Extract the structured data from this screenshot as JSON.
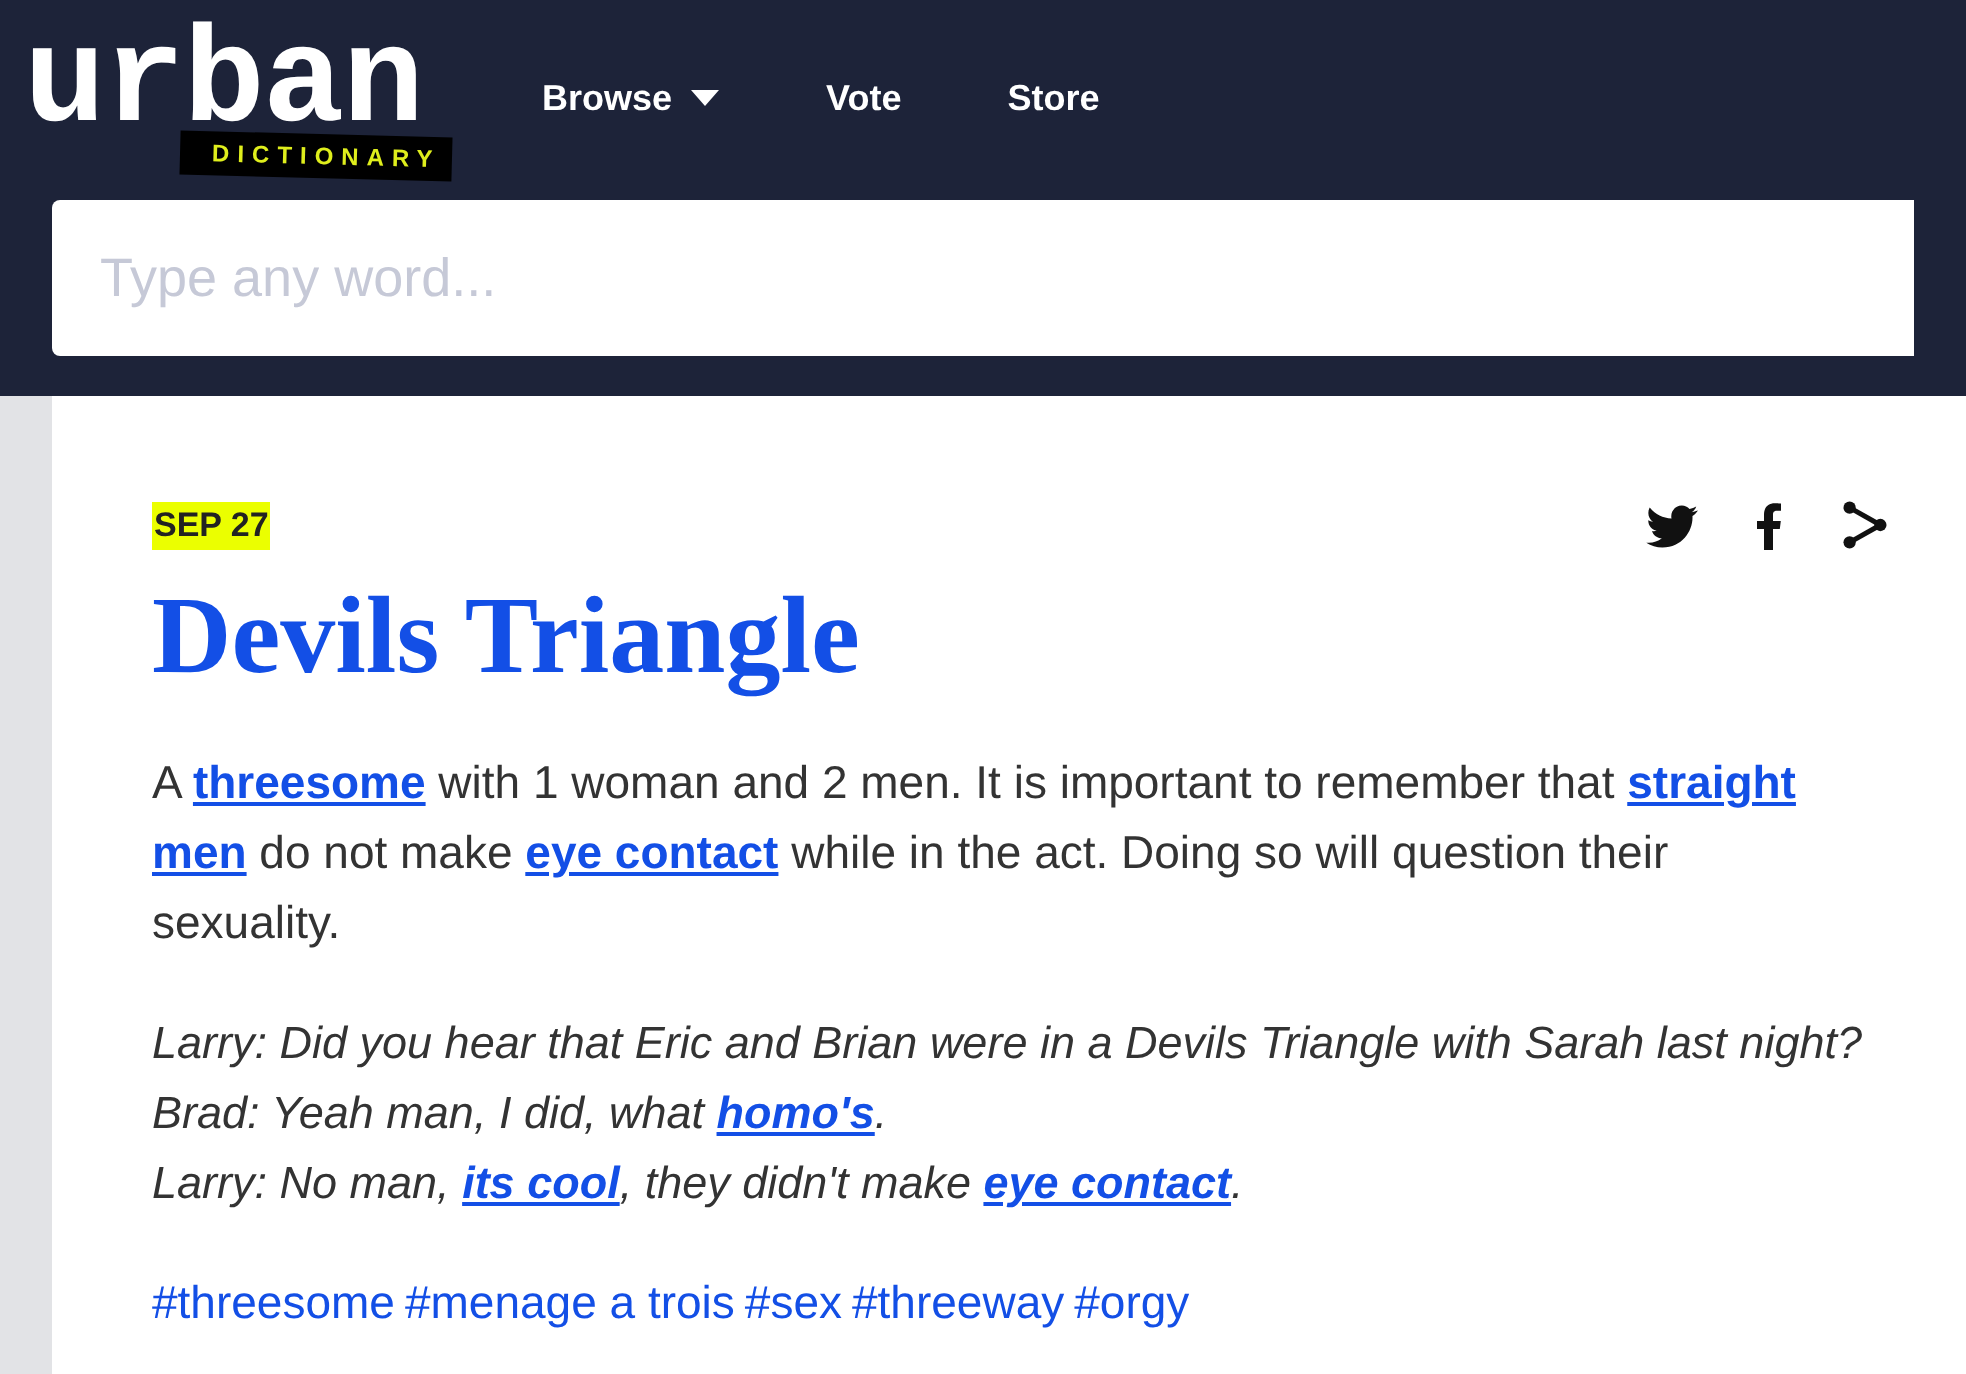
{
  "header": {
    "logo": {
      "wordmark": "urban",
      "tagline": "DICTIONARY"
    },
    "nav": [
      {
        "label": "Browse",
        "kind": "dropdown"
      },
      {
        "label": "Vote",
        "kind": "link"
      },
      {
        "label": "Store",
        "kind": "link"
      }
    ],
    "search": {
      "placeholder": "Type any word..."
    }
  },
  "entry": {
    "date": "SEP 27",
    "title": "Devils Triangle",
    "definition": [
      {
        "kind": "text",
        "text": "A "
      },
      {
        "kind": "link",
        "text": "threesome"
      },
      {
        "kind": "text",
        "text": " with 1 woman and 2 men. It is important to remember that "
      },
      {
        "kind": "link",
        "text": "straight"
      },
      {
        "kind": "link",
        "text": "men"
      },
      {
        "kind": "text",
        "text": " do not make "
      },
      {
        "kind": "link",
        "text": "eye contact"
      },
      {
        "kind": "text",
        "text": " while in the act. Doing so will question their sexuality."
      }
    ],
    "example": [
      {
        "segments": [
          {
            "kind": "text",
            "text": "Larry: Did you hear that Eric and Brian were in a Devils Triangle with Sarah last night?"
          }
        ]
      },
      {
        "segments": [
          {
            "kind": "text",
            "text": "Brad: Yeah man, I did, what "
          },
          {
            "kind": "link",
            "text": "homo's"
          },
          {
            "kind": "text",
            "text": "."
          }
        ]
      },
      {
        "segments": [
          {
            "kind": "text",
            "text": "Larry: No man, "
          },
          {
            "kind": "link",
            "text": "its cool"
          },
          {
            "kind": "text",
            "text": ", they didn't make "
          },
          {
            "kind": "link",
            "text": "eye contact"
          },
          {
            "kind": "text",
            "text": "."
          }
        ]
      }
    ],
    "tags": [
      "#threesome",
      "#menage a trois",
      "#sex",
      "#threeway",
      "#orgy"
    ]
  }
}
